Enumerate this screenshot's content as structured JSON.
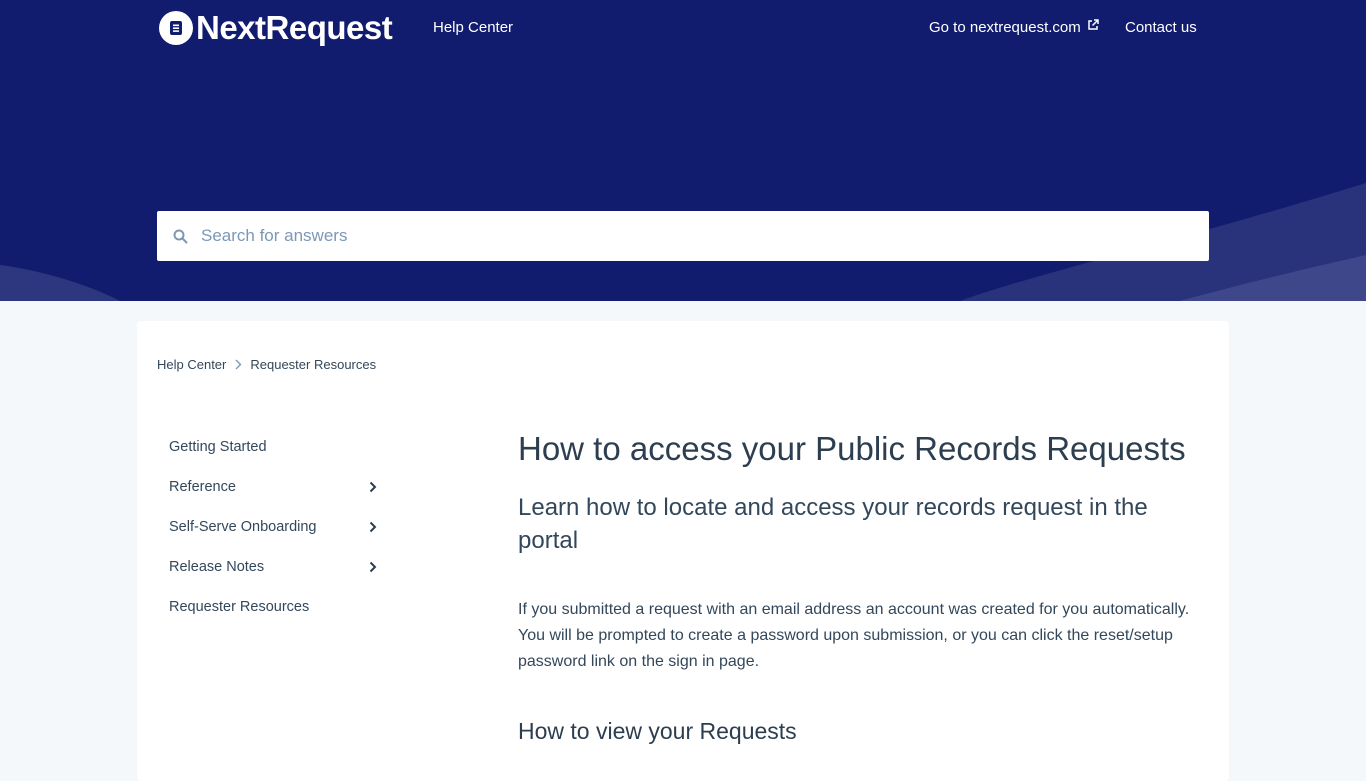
{
  "header": {
    "logo_text": "NextRequest",
    "help_center_label": "Help Center",
    "external_link_label": "Go to nextrequest.com",
    "contact_label": "Contact us"
  },
  "search": {
    "placeholder": "Search for answers"
  },
  "breadcrumb": {
    "items": [
      "Help Center",
      "Requester Resources"
    ]
  },
  "sidebar": {
    "items": [
      {
        "label": "Getting Started",
        "expandable": false
      },
      {
        "label": "Reference",
        "expandable": true
      },
      {
        "label": "Self-Serve Onboarding",
        "expandable": true
      },
      {
        "label": "Release Notes",
        "expandable": true
      },
      {
        "label": "Requester Resources",
        "expandable": false
      }
    ]
  },
  "article": {
    "title": "How to access your Public Records Requests",
    "subtitle": "Learn how to locate and access your records request in the portal",
    "body": "If you submitted a request with an email address an account was created for you automatically. You will be prompted to create a password upon submission, or you can click the reset/setup password link on the sign in page.",
    "section_heading": "How to view your Requests"
  },
  "colors": {
    "header_bg": "#111c6e",
    "page_bg": "#f5f8fb",
    "text": "#33475b",
    "search_icon": "#7c98b6"
  }
}
